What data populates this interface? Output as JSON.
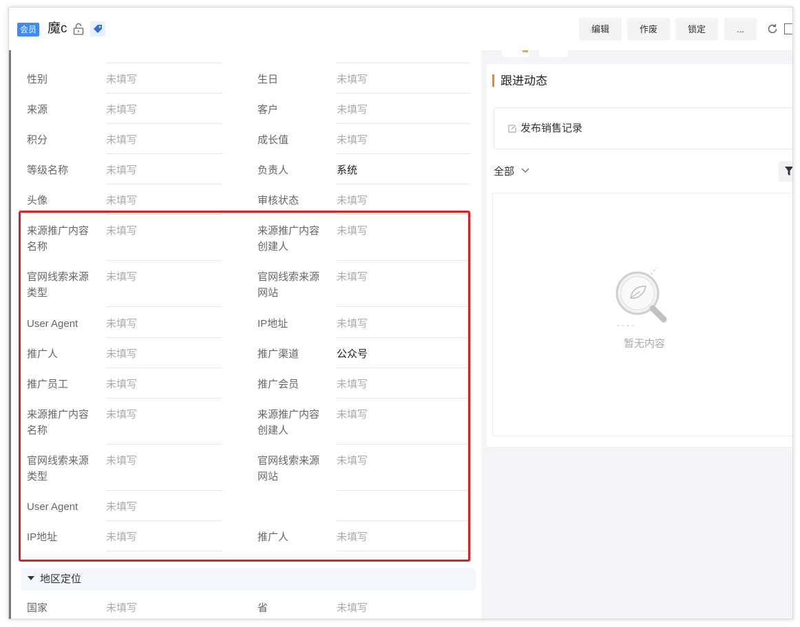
{
  "header": {
    "member_tag": "会员",
    "title": "魔c",
    "buttons": {
      "edit": "编辑",
      "void": "作废",
      "lock": "锁定",
      "more": "..."
    }
  },
  "placeholder": "未填写",
  "rows": {
    "r1": {
      "l1": "性别",
      "v1": "未填写",
      "l2": "生日",
      "v2": "未填写"
    },
    "r2": {
      "l1": "来源",
      "v1": "未填写",
      "l2": "客户",
      "v2": "未填写"
    },
    "r3": {
      "l1": "积分",
      "v1": "未填写",
      "l2": "成长值",
      "v2": "未填写"
    },
    "r4": {
      "l1": "等级名称",
      "v1": "未填写",
      "l2": "负责人",
      "v2": "系统"
    },
    "r5": {
      "l1": "头像",
      "v1": "未填写",
      "l2": "审核状态",
      "v2": "未填写"
    },
    "r6": {
      "l1a": "来源推广内容",
      "l1b": "名称",
      "v1": "未填写",
      "l2a": "来源推广内容",
      "l2b": "创建人",
      "v2": "未填写"
    },
    "r7": {
      "l1a": "官网线索来源",
      "l1b": "类型",
      "v1": "未填写",
      "l2a": "官网线索来源",
      "l2b": "网站",
      "v2": "未填写"
    },
    "r8": {
      "l1": "User Agent",
      "v1": "未填写",
      "l2": "IP地址",
      "v2": "未填写"
    },
    "r9": {
      "l1": "推广人",
      "v1": "未填写",
      "l2": "推广渠道",
      "v2": "公众号"
    },
    "r10": {
      "l1": "推广员工",
      "v1": "未填写",
      "l2": "推广会员",
      "v2": "未填写"
    },
    "r11": {
      "l1a": "来源推广内容",
      "l1b": "名称",
      "v1": "未填写",
      "l2a": "来源推广内容",
      "l2b": "创建人",
      "v2": "未填写"
    },
    "r12": {
      "l1a": "官网线索来源",
      "l1b": "类型",
      "v1": "未填写",
      "l2a": "官网线索来源",
      "l2b": "网站",
      "v2": "未填写"
    },
    "r13": {
      "l1": "User Agent",
      "v1": "未填写"
    },
    "r14": {
      "l1": "IP地址",
      "v1": "未填写",
      "l2": "推广人",
      "v2": "未填写"
    },
    "r15": {
      "l1": "国家",
      "v1": "未填写",
      "l2": "省",
      "v2": "未填写"
    }
  },
  "region_section": {
    "title": "地区定位"
  },
  "follow": {
    "title": "跟进动态",
    "publish": "发布销售记录",
    "filter": "全部",
    "empty": "暂无内容"
  },
  "colors": {
    "accent": "#3d8bfd",
    "highlight": "#e02020",
    "follow_accent": "#f5841f"
  }
}
